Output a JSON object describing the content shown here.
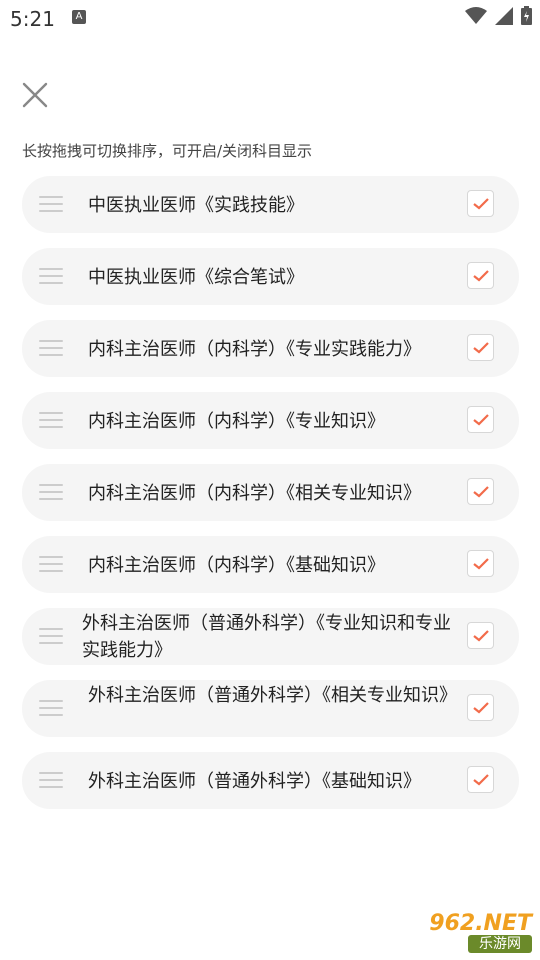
{
  "status_bar": {
    "time": "5:21",
    "notification_icon_letter": "A"
  },
  "hint": "长按拖拽可切换排序，可开启/关闭科目显示",
  "rows": [
    {
      "label": "中医执业医师《实践技能》",
      "checked": true
    },
    {
      "label": "中医执业医师《综合笔试》",
      "checked": true
    },
    {
      "label": "内科主治医师（内科学）《专业实践能力》",
      "checked": true
    },
    {
      "label": "内科主治医师（内科学）《专业知识》",
      "checked": true
    },
    {
      "label": "内科主治医师（内科学）《相关专业知识》",
      "checked": true
    },
    {
      "label": "内科主治医师（内科学）《基础知识》",
      "checked": true
    },
    {
      "label": "外科主治医师（普通外科学）《专业知识和专业实践能力》",
      "checked": true
    },
    {
      "label": "外科主治医师（普通外科学）《相关专业知识》",
      "checked": true
    },
    {
      "label": "外科主治医师（普通外科学）《基础知识》",
      "checked": true
    }
  ],
  "watermark": {
    "top": "962.NET",
    "bottom": "乐游网"
  },
  "colors": {
    "accent": "#f26b4a",
    "row_bg": "#f5f5f5",
    "handle": "#cccccc"
  }
}
